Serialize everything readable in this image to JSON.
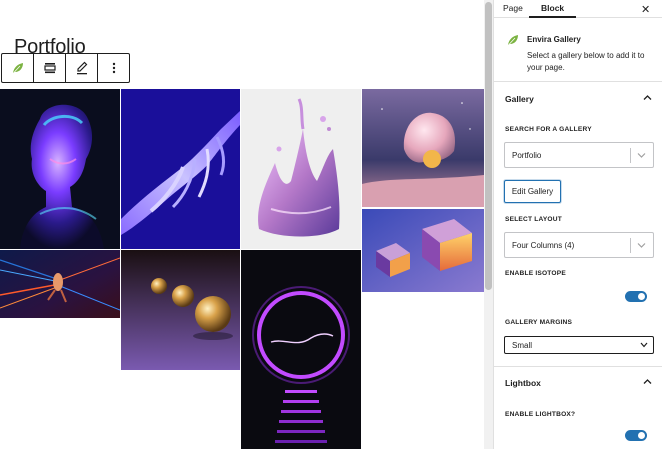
{
  "editor": {
    "page_title": "Portfolio",
    "toolbar": {
      "items": [
        "envira-block-icon",
        "align-icon",
        "edit-pencil-icon",
        "more-options-icon"
      ]
    },
    "gallery": {
      "layout_columns": 4,
      "images": [
        "chrome-bust-sculpture",
        "holographic-hand",
        "liquid-metal-splash",
        "pink-cloth-sphere",
        "light-speed-runner",
        "golden-spheres",
        "neon-circle-portal",
        "neon-cubes"
      ]
    }
  },
  "sidebar": {
    "tabs": [
      {
        "label": "Page",
        "active": false
      },
      {
        "label": "Block",
        "active": true
      }
    ],
    "close_icon": "close-icon",
    "block": {
      "name": "Envira Gallery",
      "description": "Select a gallery below to add it to your page.",
      "icon": "envira-leaf-icon"
    },
    "gallery_panel": {
      "title": "Gallery",
      "search_label": "SEARCH FOR A GALLERY",
      "search_value": "Portfolio",
      "edit_button": "Edit Gallery",
      "layout_label": "SELECT LAYOUT",
      "layout_value": "Four Columns (4)",
      "isotope_label": "ENABLE ISOTOPE",
      "isotope_enabled": true,
      "margins_label": "GALLERY MARGINS",
      "margins_value": "Small"
    },
    "lightbox_panel": {
      "title": "Lightbox",
      "enable_label": "ENABLE LIGHTBOX?",
      "enabled": true
    }
  },
  "colors": {
    "accent": "#2271b1",
    "text": "#1e1e1e",
    "border": "#e0e0e0",
    "envira_green": "#7cb342"
  }
}
